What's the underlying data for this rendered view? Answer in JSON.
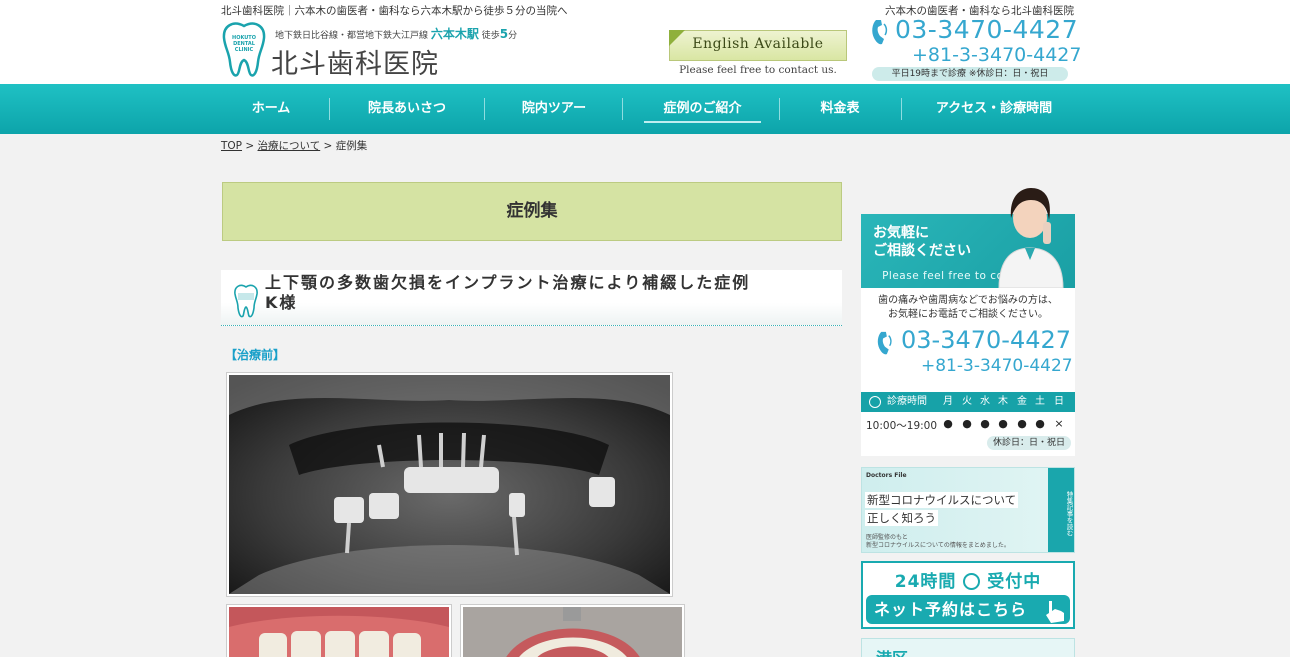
{
  "header": {
    "tagline_left": "北斗歯科医院｜六本木の歯医者・歯科なら六本木駅から徒歩５分の当院へ",
    "tagline_right": "六本木の歯医者・歯科なら北斗歯科医院",
    "logo_badge": "HOKUTO DENTAL CLINIC",
    "access_prefix": "地下鉄日比谷線・都営地下鉄大江戸線",
    "access_station": "六本木駅",
    "access_walk": "徒歩",
    "access_min": "5",
    "access_unit": "分",
    "clinic_name": "北斗歯科医院",
    "english_label": "English Available",
    "english_sub": "Please feel free to contact us.",
    "tel_main": "03-3470-4427",
    "tel_intl": "+81-3-3470-4427",
    "hours_note": "平日19時まで診療 ※休診日：日・祝日"
  },
  "nav": {
    "items": [
      "ホーム",
      "院長あいさつ",
      "院内ツアー",
      "症例のご紹介",
      "料金表",
      "アクセス・診療時間"
    ]
  },
  "breadcrumb": {
    "top": "TOP",
    "sep": ">",
    "parent": "治療について",
    "current": "症例集"
  },
  "main": {
    "page_title": "症例集",
    "case_title_1": "上下顎の多数歯欠損をインプラント治療により補綴した症例",
    "case_title_2": "K様",
    "before_label": "【治療前】"
  },
  "sidebar": {
    "contact": {
      "heading_1": "お気軽に",
      "heading_2": "ご相談ください",
      "english": "Please feel free to contact us.",
      "desc_1": "歯の痛みや歯周病などでお悩みの方は、",
      "desc_2": "お気軽にお電話でご相談ください。",
      "tel": "03-3470-4427",
      "tel_intl": "+81-3-3470-4427"
    },
    "schedule": {
      "label": "診療時間",
      "days": [
        "月",
        "火",
        "水",
        "木",
        "金",
        "土",
        "日"
      ],
      "time": "10:00〜19:00",
      "marks": [
        "●",
        "●",
        "●",
        "●",
        "●",
        "●",
        "×"
      ],
      "closed": "休診日：日・祝日"
    },
    "banner_covid": {
      "brand": "Doctors File",
      "line1": "新型コロナウイルスについて",
      "line2": "正しく知ろう",
      "sub1": "医師監修のもと",
      "sub2": "新型コロナウイルスについての情報をまとめました。",
      "side": "特集記事を読む"
    },
    "banner_reserve": {
      "top": "24時間",
      "top_suffix": "受付中",
      "button": "ネット予約はこちら"
    },
    "banner_next": {
      "text": "港区"
    }
  }
}
